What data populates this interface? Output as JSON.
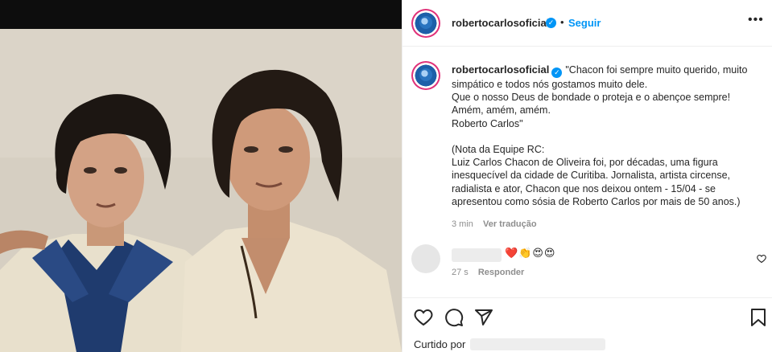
{
  "post": {
    "username": "robertocarlosoficial",
    "follow_label": "Seguir",
    "dot": "•",
    "more_label": "•••",
    "verified_glyph": "✓"
  },
  "caption": {
    "username": "robertocarlosoficial",
    "text": "\"Chacon foi sempre muito querido, muito simpático e todos nós gostamos muito dele.\nQue o nosso Deus de bondade o proteja e o abençoe sempre!\nAmém, amém, amém.\nRoberto Carlos\"\n\n(Nota da Equipe RC:\nLuiz Carlos Chacon de Oliveira foi, por décadas, uma figura inesquecível da cidade de Curitiba. Jornalista, artista circense, radialista e ator, Chacon que nos deixou ontem - 15/04 - se apresentou como sósia de Roberto Carlos por mais de 50 anos.)",
    "time": "3 min",
    "translate_label": "Ver tradução"
  },
  "comment": {
    "emojis": "❤️👏😍😍",
    "time": "27 s",
    "reply_label": "Responder"
  },
  "actions": {
    "liked_by_label": "Curtido por"
  },
  "colors": {
    "accent": "#0095f6",
    "text": "#262626",
    "muted": "#8e8e8e",
    "border": "#efefef"
  },
  "icons": [
    "verified-badge-icon",
    "more-options-icon",
    "heart-icon",
    "comment-icon",
    "share-icon",
    "bookmark-icon"
  ]
}
